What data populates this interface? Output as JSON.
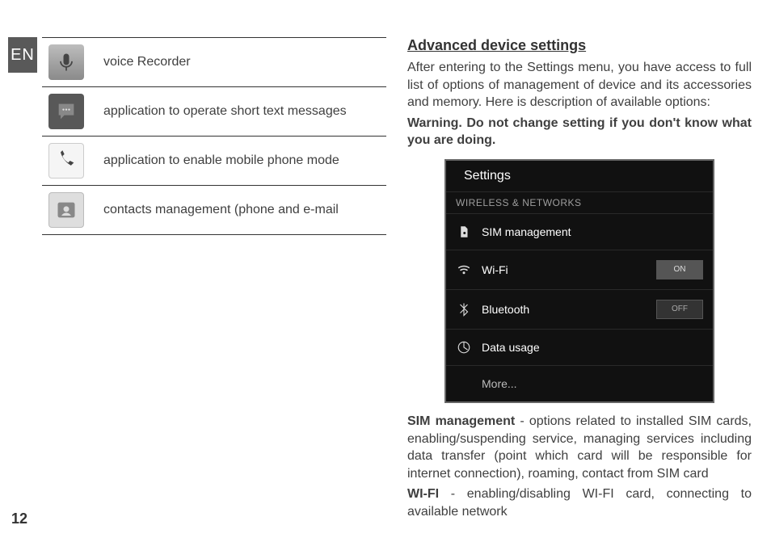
{
  "lang_tab": "EN",
  "page_number": "12",
  "left": {
    "apps": [
      {
        "icon": "recorder",
        "desc": "voice Recorder"
      },
      {
        "icon": "sms",
        "desc": "application to operate short text messages"
      },
      {
        "icon": "phone",
        "desc": "application to enable mobile phone mode"
      },
      {
        "icon": "contacts",
        "desc": "contacts management (phone and e-mail"
      }
    ]
  },
  "right": {
    "section_title": "Advanced device settings",
    "intro": "After entering to the Settings menu, you have access to full list of options of management of device and its accessories and memory. Here is description of available options:",
    "warning": "Warning. Do not change setting if you don't know what you are doing.",
    "settings_screenshot": {
      "header_icon": "settings-icon",
      "header_label": "Settings",
      "section_label": "WIRELESS & NETWORKS",
      "rows": [
        {
          "icon": "sim-icon",
          "label": "SIM management",
          "toggle": null
        },
        {
          "icon": "wifi-icon",
          "label": "Wi-Fi",
          "toggle": "ON"
        },
        {
          "icon": "bluetooth-icon",
          "label": "Bluetooth",
          "toggle": "OFF"
        },
        {
          "icon": "data-icon",
          "label": "Data usage",
          "toggle": null
        },
        {
          "icon": null,
          "label": "More...",
          "toggle": null
        }
      ]
    },
    "sim_label": "SIM management",
    "sim_desc": " - options related to installed SIM cards, enabling/suspending service, managing services including data transfer (point which card will be responsible for internet connection), roaming, contact from SIM card",
    "wifi_label": "WI-FI",
    "wifi_desc": " - enabling/disabling WI-FI card, connecting to available network"
  }
}
